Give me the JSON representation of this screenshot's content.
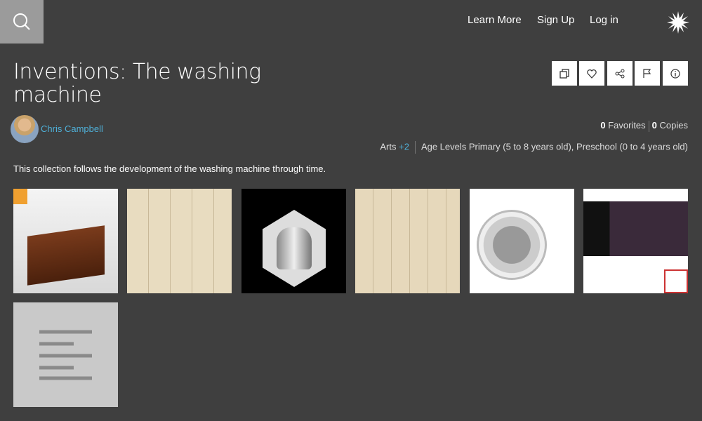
{
  "header": {
    "nav": [
      "Learn More",
      "Sign Up",
      "Log in"
    ],
    "icons": [
      "search-icon",
      "sunburst-logo-icon"
    ]
  },
  "collection": {
    "title": "Inventions: The washing machine",
    "actions": [
      "copy-icon",
      "heart-icon",
      "share-icon",
      "flag-icon",
      "info-icon"
    ],
    "author": "Chris Campbell",
    "favorites_count": "0",
    "favorites_label": "Favorites",
    "copies_count": "0",
    "copies_label": "Copies",
    "subject": "Arts",
    "subject_more": "+2",
    "age_levels": "Age Levels Primary (5 to 8 years old), Preschool (0 to 4 years old)",
    "description": "This collection follows the development of the washing machine through time."
  },
  "items": [
    {
      "type": "image",
      "subject": "antique wooden washing machine"
    },
    {
      "type": "image",
      "subject": "patent drawing"
    },
    {
      "type": "image",
      "subject": "washing machine drum render"
    },
    {
      "type": "image",
      "subject": "patent drawing"
    },
    {
      "type": "image",
      "subject": "modern front-loading washing machine"
    },
    {
      "type": "video",
      "subject": "talk video page"
    },
    {
      "type": "text",
      "subject": "text resource"
    }
  ],
  "colors": {
    "background": "#3f3f3f",
    "link": "#4fb0d8",
    "search_bg": "#9b9b9b"
  }
}
